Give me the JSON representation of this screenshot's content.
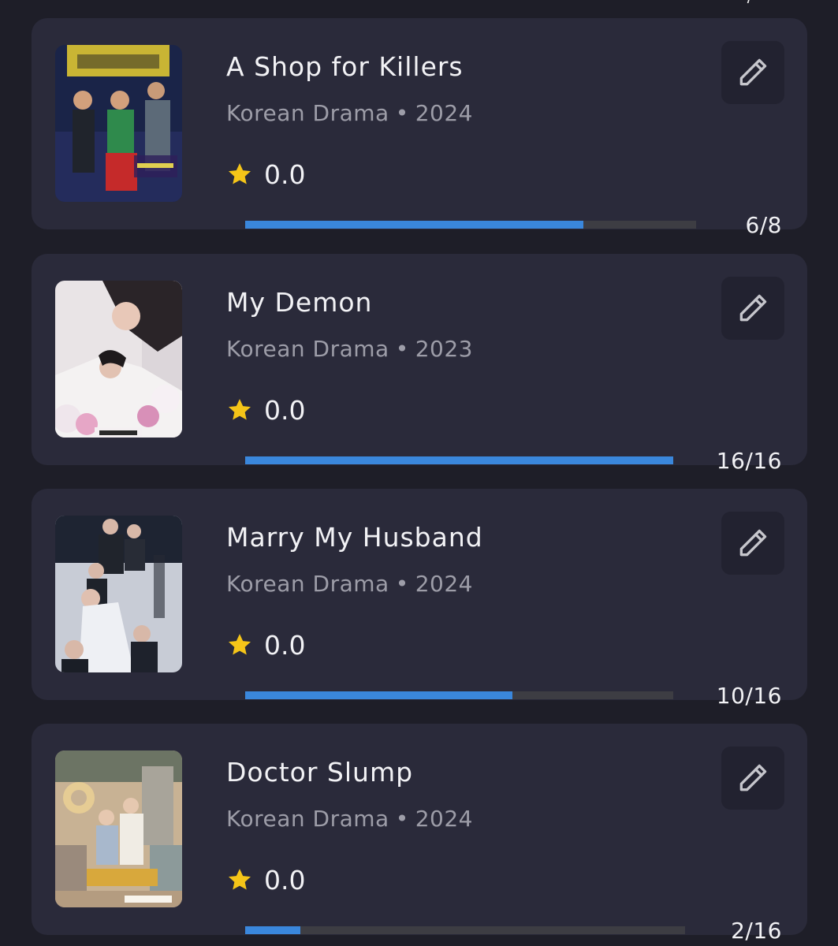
{
  "items": [
    {
      "title": "A Shop for Killers",
      "category": "Korean Drama",
      "separator": "•",
      "year": "2024",
      "rating": "0.0",
      "watched": 6,
      "total": 8,
      "progress_label": "6/8"
    },
    {
      "title": "My Demon",
      "category": "Korean Drama",
      "separator": "•",
      "year": "2023",
      "rating": "0.0",
      "watched": 16,
      "total": 16,
      "progress_label": "16/16"
    },
    {
      "title": "Marry My Husband",
      "category": "Korean Drama",
      "separator": "•",
      "year": "2024",
      "rating": "0.0",
      "watched": 10,
      "total": 16,
      "progress_label": "10/16"
    },
    {
      "title": "Doctor Slump",
      "category": "Korean Drama",
      "separator": "•",
      "year": "2024",
      "rating": "0.0",
      "watched": 2,
      "total": 16,
      "progress_label": "2/16"
    }
  ],
  "icons": {
    "rating": "star-icon",
    "edit": "pencil-icon"
  },
  "colors": {
    "background": "#1e1e28",
    "card": "#2a2a3a",
    "progress_fill": "#3a87dc",
    "progress_track": "#3d3d43",
    "star": "#f5c518"
  }
}
